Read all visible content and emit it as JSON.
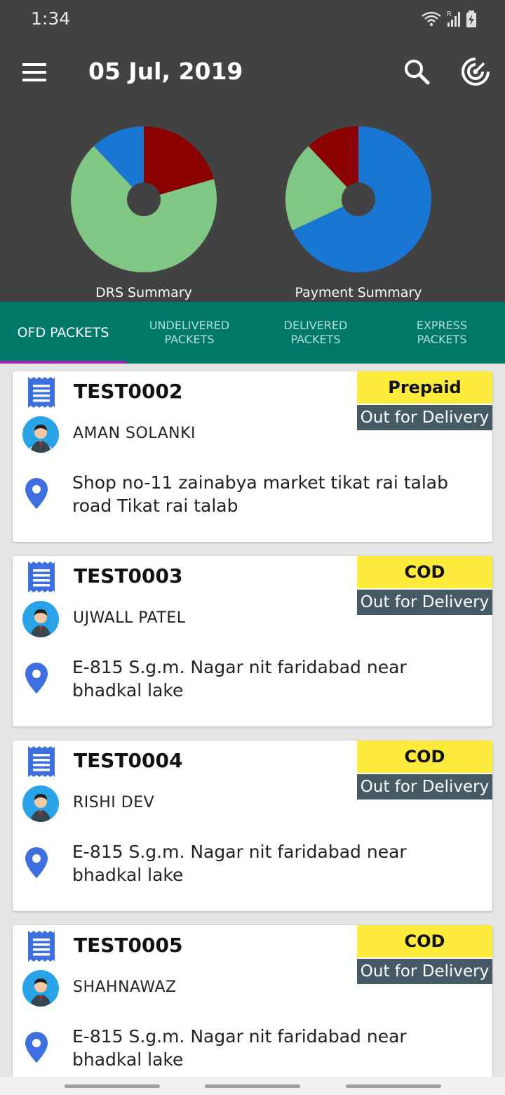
{
  "status_bar": {
    "time": "1:34",
    "roaming_indicator": "R"
  },
  "app_bar": {
    "title": "05 Jul, 2019"
  },
  "charts": {
    "drs": {
      "label": "DRS Summary"
    },
    "payment": {
      "label": "Payment Summary"
    }
  },
  "chart_data": [
    {
      "type": "pie",
      "title": "DRS Summary",
      "values": [
        0.205,
        0.675,
        0.12
      ],
      "colors": [
        "#8b0000",
        "#81c784",
        "#1976d2"
      ]
    },
    {
      "type": "pie",
      "title": "Payment Summary",
      "values": [
        0.68,
        0.2,
        0.12
      ],
      "colors": [
        "#1976d2",
        "#81c784",
        "#8b0000"
      ]
    }
  ],
  "tabs": [
    {
      "label": "OFD PACKETS",
      "active": true
    },
    {
      "label": "UNDELIVERED\nPACKETS",
      "active": false
    },
    {
      "label": "DELIVERED\nPACKETS",
      "active": false
    },
    {
      "label": "EXPRESS\nPACKETS",
      "active": false
    }
  ],
  "packets": [
    {
      "id": "TEST0002",
      "payment": "Prepaid",
      "status": "Out for Delivery",
      "name": "AMAN SOLANKI",
      "address": "Shop no-11 zainabya market tikat rai talab road Tikat rai talab"
    },
    {
      "id": "TEST0003",
      "payment": "COD",
      "status": "Out for Delivery",
      "name": "UJWALL PATEL",
      "address": "E-815 S.g.m. Nagar nit faridabad near bhadkal lake"
    },
    {
      "id": "TEST0004",
      "payment": "COD",
      "status": "Out for Delivery",
      "name": "RISHI DEV",
      "address": "E-815 S.g.m. Nagar nit faridabad near bhadkal lake"
    },
    {
      "id": "TEST0005",
      "payment": "COD",
      "status": "Out for Delivery",
      "name": "SHAHNAWAZ",
      "address": "E-815 S.g.m. Nagar nit faridabad near bhadkal lake"
    }
  ],
  "icons": {
    "menu": "menu-icon",
    "search": "search-icon",
    "radar": "radar-icon",
    "packet": "receipt-icon",
    "person": "person-avatar-icon",
    "location": "location-pin-icon"
  },
  "colors": {
    "app_bar": "#424242",
    "tabs": "#00796b",
    "tab_indicator": "#9c27b0",
    "payment_badge": "#ffeb3b",
    "status_badge": "#455a64",
    "icon_blue": "#3d6fe0"
  }
}
